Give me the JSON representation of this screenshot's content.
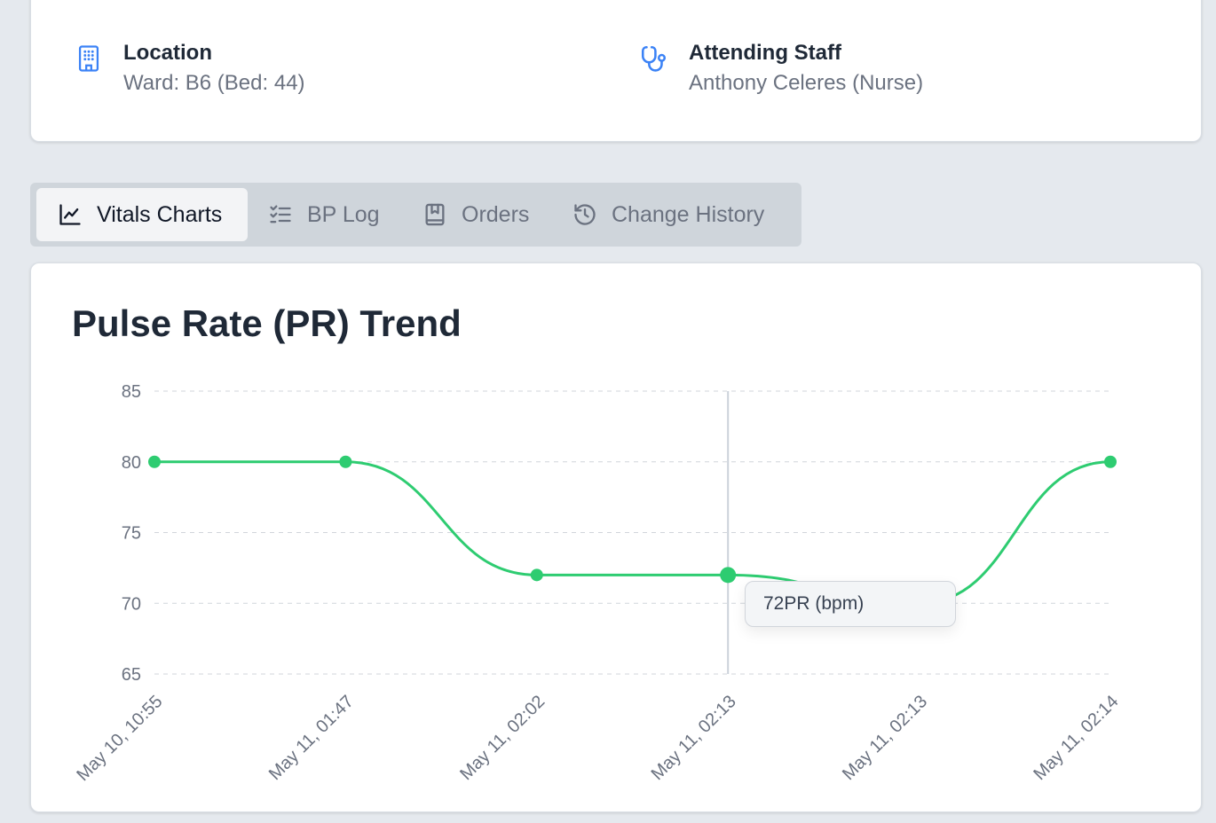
{
  "info": {
    "location": {
      "label": "Location",
      "value": "Ward: B6 (Bed: 44)",
      "icon": "building-icon"
    },
    "staff": {
      "label": "Attending Staff",
      "value": "Anthony Celeres (Nurse)",
      "icon": "stethoscope-icon"
    }
  },
  "tabs": [
    {
      "label": "Vitals Charts",
      "icon": "line-chart-icon",
      "active": true
    },
    {
      "label": "BP Log",
      "icon": "checklist-icon",
      "active": false
    },
    {
      "label": "Orders",
      "icon": "bookmark-book-icon",
      "active": false
    },
    {
      "label": "Change History",
      "icon": "history-icon",
      "active": false
    }
  ],
  "chart": {
    "title": "Pulse Rate (PR) Trend",
    "tooltip": {
      "value": "72",
      "label": "PR (bpm)"
    }
  },
  "colors": {
    "line": "#2ecc71",
    "grid": "#d1d5db",
    "accent": "#3b82f6"
  },
  "chart_data": {
    "type": "line",
    "categories": [
      "May 10, 10:55",
      "May 11, 01:47",
      "May 11, 02:02",
      "May 11, 02:13",
      "May 11, 02:13",
      "May 11, 02:14"
    ],
    "series": [
      {
        "name": "PR (bpm)",
        "values": [
          80,
          80,
          72,
          72,
          70,
          80
        ]
      }
    ],
    "ylim": [
      65,
      85
    ],
    "yticks": [
      65,
      70,
      75,
      80,
      85
    ],
    "grid": true,
    "active_index": 3
  }
}
